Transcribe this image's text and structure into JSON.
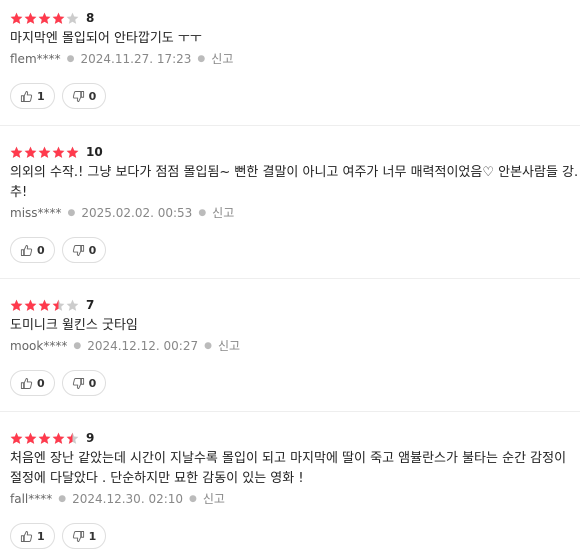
{
  "reviews": [
    {
      "stars": 4,
      "score": "8",
      "text": "마지막엔 몰입되어 안타깝기도 ㅜㅜ",
      "user": "flem****",
      "date": "2024.11.27. 17:23",
      "report": "신고",
      "likes": "1",
      "dislikes": "0"
    },
    {
      "stars": 5,
      "score": "10",
      "text": "의외의 수작.! 그냥 보다가 점점 몰입됨~ 뻔한 결말이 아니고 여주가 너무 매력적이었음♡ 안본사람들 강.추!",
      "user": "miss****",
      "date": "2025.02.02. 00:53",
      "report": "신고",
      "likes": "0",
      "dislikes": "0"
    },
    {
      "stars": 3.5,
      "score": "7",
      "text": "도미니크 윌킨스 굿타임",
      "user": "mook****",
      "date": "2024.12.12. 00:27",
      "report": "신고",
      "likes": "0",
      "dislikes": "0"
    },
    {
      "stars": 4.5,
      "score": "9",
      "text": "처음엔 장난 같았는데 시간이 지날수록 몰입이 되고 마지막에 딸이 죽고 앰뷸란스가 불타는 순간 감정이 절정에 다달았다 . 단순하지만 묘한 감동이 있는 영화 !",
      "user": "fall****",
      "date": "2024.12.30. 02:10",
      "report": "신고",
      "likes": "1",
      "dislikes": "1"
    }
  ],
  "colors": {
    "star_on": "#ff3a4d",
    "star_off": "#cccccc",
    "meta": "#888888"
  },
  "icons": {
    "like": "thumbs-up-icon",
    "dislike": "thumbs-down-icon"
  }
}
